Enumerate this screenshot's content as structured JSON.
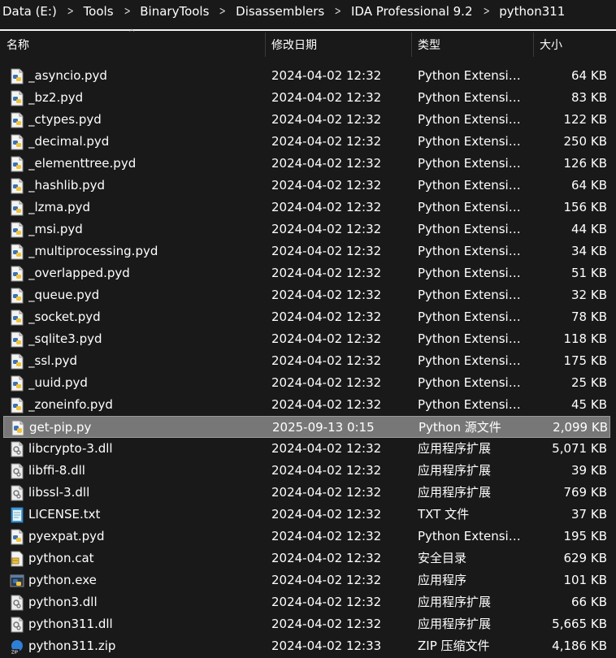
{
  "breadcrumb": [
    "Data (E:)",
    "Tools",
    "BinaryTools",
    "Disassemblers",
    "IDA Professional 9.2",
    "python311"
  ],
  "columns": {
    "name": "名称",
    "date": "修改日期",
    "type": "类型",
    "size": "大小"
  },
  "colors": {
    "background": "#191919",
    "selected_row": "#777777",
    "text": "#ffffff"
  },
  "files": [
    {
      "name": "_asyncio.pyd",
      "date": "2024-04-02 12:32",
      "type": "Python Extension Module",
      "size": "64 KB",
      "icon": "python-extension-icon"
    },
    {
      "name": "_bz2.pyd",
      "date": "2024-04-02 12:32",
      "type": "Python Extension Module",
      "size": "83 KB",
      "icon": "python-extension-icon"
    },
    {
      "name": "_ctypes.pyd",
      "date": "2024-04-02 12:32",
      "type": "Python Extension Module",
      "size": "122 KB",
      "icon": "python-extension-icon"
    },
    {
      "name": "_decimal.pyd",
      "date": "2024-04-02 12:32",
      "type": "Python Extension Module",
      "size": "250 KB",
      "icon": "python-extension-icon"
    },
    {
      "name": "_elementtree.pyd",
      "date": "2024-04-02 12:32",
      "type": "Python Extension Module",
      "size": "126 KB",
      "icon": "python-extension-icon"
    },
    {
      "name": "_hashlib.pyd",
      "date": "2024-04-02 12:32",
      "type": "Python Extension Module",
      "size": "64 KB",
      "icon": "python-extension-icon"
    },
    {
      "name": "_lzma.pyd",
      "date": "2024-04-02 12:32",
      "type": "Python Extension Module",
      "size": "156 KB",
      "icon": "python-extension-icon"
    },
    {
      "name": "_msi.pyd",
      "date": "2024-04-02 12:32",
      "type": "Python Extension Module",
      "size": "44 KB",
      "icon": "python-extension-icon"
    },
    {
      "name": "_multiprocessing.pyd",
      "date": "2024-04-02 12:32",
      "type": "Python Extension Module",
      "size": "34 KB",
      "icon": "python-extension-icon"
    },
    {
      "name": "_overlapped.pyd",
      "date": "2024-04-02 12:32",
      "type": "Python Extension Module",
      "size": "51 KB",
      "icon": "python-extension-icon"
    },
    {
      "name": "_queue.pyd",
      "date": "2024-04-02 12:32",
      "type": "Python Extension Module",
      "size": "32 KB",
      "icon": "python-extension-icon"
    },
    {
      "name": "_socket.pyd",
      "date": "2024-04-02 12:32",
      "type": "Python Extension Module",
      "size": "78 KB",
      "icon": "python-extension-icon"
    },
    {
      "name": "_sqlite3.pyd",
      "date": "2024-04-02 12:32",
      "type": "Python Extension Module",
      "size": "118 KB",
      "icon": "python-extension-icon"
    },
    {
      "name": "_ssl.pyd",
      "date": "2024-04-02 12:32",
      "type": "Python Extension Module",
      "size": "175 KB",
      "icon": "python-extension-icon"
    },
    {
      "name": "_uuid.pyd",
      "date": "2024-04-02 12:32",
      "type": "Python Extension Module",
      "size": "25 KB",
      "icon": "python-extension-icon"
    },
    {
      "name": "_zoneinfo.pyd",
      "date": "2024-04-02 12:32",
      "type": "Python Extension Module",
      "size": "45 KB",
      "icon": "python-extension-icon"
    },
    {
      "name": "get-pip.py",
      "date": "2025-09-13 0:15",
      "type": "Python 源文件",
      "size": "2,099 KB",
      "icon": "python-source-icon",
      "selected": true
    },
    {
      "name": "libcrypto-3.dll",
      "date": "2024-04-02 12:32",
      "type": "应用程序扩展",
      "size": "5,071 KB",
      "icon": "dll-icon"
    },
    {
      "name": "libffi-8.dll",
      "date": "2024-04-02 12:32",
      "type": "应用程序扩展",
      "size": "39 KB",
      "icon": "dll-icon"
    },
    {
      "name": "libssl-3.dll",
      "date": "2024-04-02 12:32",
      "type": "应用程序扩展",
      "size": "769 KB",
      "icon": "dll-icon"
    },
    {
      "name": "LICENSE.txt",
      "date": "2024-04-02 12:32",
      "type": "TXT 文件",
      "size": "37 KB",
      "icon": "text-file-icon"
    },
    {
      "name": "pyexpat.pyd",
      "date": "2024-04-02 12:32",
      "type": "Python Extension Module",
      "size": "195 KB",
      "icon": "python-extension-icon"
    },
    {
      "name": "python.cat",
      "date": "2024-04-02 12:32",
      "type": "安全目录",
      "size": "629 KB",
      "icon": "security-catalog-icon"
    },
    {
      "name": "python.exe",
      "date": "2024-04-02 12:32",
      "type": "应用程序",
      "size": "101 KB",
      "icon": "python-exe-icon"
    },
    {
      "name": "python3.dll",
      "date": "2024-04-02 12:32",
      "type": "应用程序扩展",
      "size": "66 KB",
      "icon": "dll-icon"
    },
    {
      "name": "python311.dll",
      "date": "2024-04-02 12:32",
      "type": "应用程序扩展",
      "size": "5,665 KB",
      "icon": "dll-icon"
    },
    {
      "name": "python311.zip",
      "date": "2024-04-02 12:33",
      "type": "ZIP 压缩文件",
      "size": "4,186 KB",
      "icon": "zip-icon"
    }
  ]
}
